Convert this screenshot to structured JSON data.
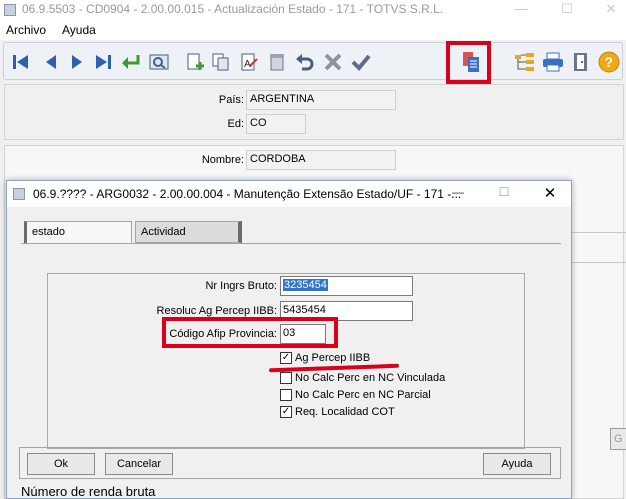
{
  "window": {
    "title": "06.9.5503 - CD0904 - 2.00.00.015 - Actualización Estado - 171 - TOTVS S.R.L.",
    "minimize": "—",
    "maximize": "☐",
    "close": "✕"
  },
  "menu": [
    "Archivo",
    "Ayuda"
  ],
  "toolbar": {
    "icons": [
      "first-icon",
      "previous-icon",
      "next-icon",
      "last-icon",
      "return-icon",
      "search-icon",
      "new-icon",
      "copy-icon",
      "edit-icon",
      "delete-icon",
      "undo-icon",
      "cancel-icon",
      "confirm-icon",
      "extension-icon",
      "tree-icon",
      "print-icon",
      "exit-icon",
      "help-icon"
    ],
    "help_glyph": "?"
  },
  "form": {
    "pais_label": "País:",
    "pais_value": "ARGENTINA",
    "ed_label": "Ed:",
    "ed_value": "CO",
    "nombre_label": "Nombre:",
    "nombre_value": "CORDOBA",
    "right_button_partial": "G"
  },
  "dialog": {
    "title": "06.9.???? - ARG0032 - 2.00.00.004 - Manutenção Extensão Estado/UF - 171 -...",
    "minimize": "—",
    "maximize": "☐",
    "close": "✕",
    "tabs": [
      "estado",
      "Actividad"
    ],
    "fields": [
      {
        "label": "Nr Ingrs Bruto:",
        "value": "3235454"
      },
      {
        "label": "Resoluc Ag Percep IIBB:",
        "value": "5435454"
      },
      {
        "label": "Código Afip Provincia:",
        "value": "03"
      }
    ],
    "checkboxes": [
      {
        "label": "Ag Percep IIBB",
        "checked": true
      },
      {
        "label": "No Calc Perc en NC Vinculada",
        "checked": false
      },
      {
        "label": "No Calc Perc en NC Parcial",
        "checked": false
      },
      {
        "label": "Req. Localidad COT",
        "checked": true
      }
    ],
    "buttons": {
      "ok": "Ok",
      "cancel": "Cancelar",
      "help": "Ayuda"
    },
    "status": "Número de renda bruta"
  },
  "colors": {
    "highlight": "#d9001b",
    "selection": "#3174c8"
  }
}
